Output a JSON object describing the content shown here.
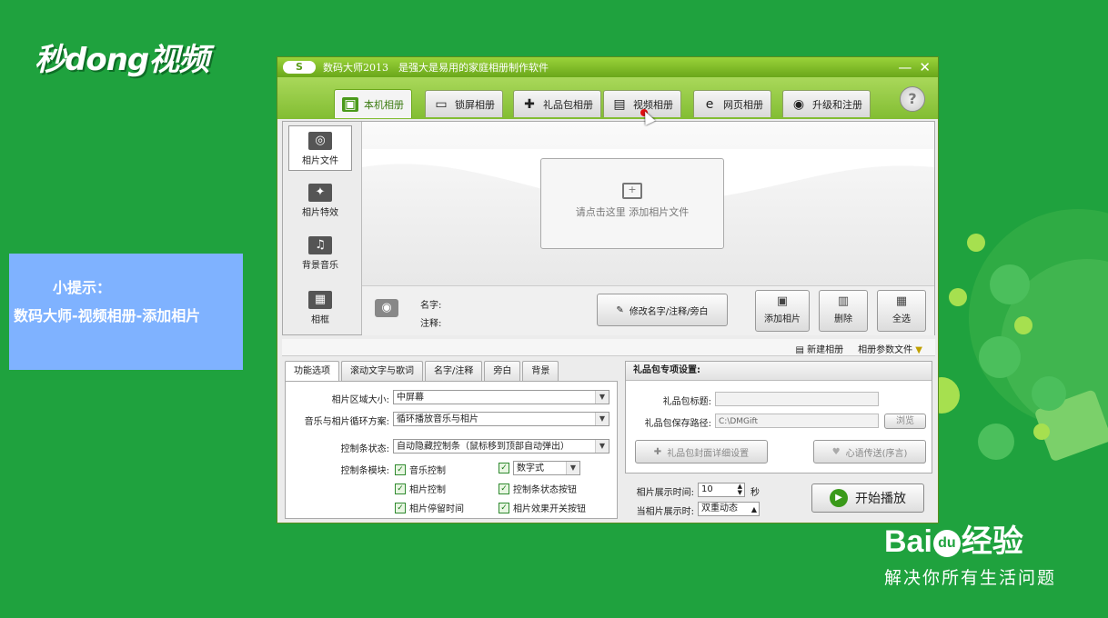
{
  "watermark": {
    "logo": "秒dong视频"
  },
  "tip": {
    "title": "小提示：",
    "text": "数码大师-视频相册-添加相片"
  },
  "baidu": {
    "logo_a": "Bai",
    "logo_du": "du",
    "logo_b": "经验",
    "slogan": "解决你所有生活问题"
  },
  "window": {
    "logo": "S",
    "title": "数码大师2013　是强大是易用的家庭相册制作软件",
    "minimize": "—",
    "close": "✕"
  },
  "tabs": [
    {
      "label": "本机相册",
      "icon": "person-photo-icon",
      "glyph": "▣"
    },
    {
      "label": "锁屏相册",
      "icon": "monitor-icon",
      "glyph": "▭"
    },
    {
      "label": "礼品包相册",
      "icon": "gift-icon",
      "glyph": "✚"
    },
    {
      "label": "视频相册",
      "icon": "film-icon",
      "glyph": "▤"
    },
    {
      "label": "网页相册",
      "icon": "ie-icon",
      "glyph": "e"
    },
    {
      "label": "升级和注册",
      "icon": "globe-icon",
      "glyph": "◉"
    }
  ],
  "help": "?",
  "sidenav": [
    {
      "label": "相片文件",
      "glyph": "◎"
    },
    {
      "label": "相片特效",
      "glyph": "✦"
    },
    {
      "label": "背景音乐",
      "glyph": "♫"
    },
    {
      "label": "相框",
      "glyph": "▦"
    }
  ],
  "canvas": {
    "add_hint": "请点击这里  添加相片文件",
    "add_glyph": "+"
  },
  "info": {
    "name_label": "名字:",
    "note_label": "注释:"
  },
  "actions": {
    "edit": "修改名字/注释/旁白",
    "add": "添加相片",
    "delete": "删除",
    "select_all": "全选"
  },
  "toolstrip": {
    "new_album": "新建相册",
    "album_params": "相册参数文件"
  },
  "subtabs": [
    "功能选项",
    "滚动文字与歌词",
    "名字/注释",
    "旁白",
    "背景"
  ],
  "options": {
    "area_label": "相片区域大小:",
    "area_value": "中屏幕",
    "loop_label": "音乐与相片循环方案:",
    "loop_value": "循环播放音乐与相片",
    "ctrl_state_label": "控制条状态:",
    "ctrl_state_value": "自动隐藏控制条（鼠标移到顶部自动弹出）",
    "ctrl_module_label": "控制条模块:",
    "checks": [
      {
        "label": "音乐控制",
        "checked": true
      },
      {
        "label": "数字式",
        "checked": true,
        "select": true
      },
      {
        "label": "相片控制",
        "checked": true
      },
      {
        "label": "控制条状态按钮",
        "checked": true
      },
      {
        "label": "相片停留时间",
        "checked": true
      },
      {
        "label": "相片效果开关按钮",
        "checked": true
      }
    ]
  },
  "gift": {
    "header": "礼品包专项设置:",
    "title_label": "礼品包标题:",
    "title_value": "",
    "path_label": "礼品包保存路径:",
    "path_value": "C:\\DMGift",
    "browse": "浏览",
    "cover_btn": "礼品包封面详细设置",
    "heart_btn": "心语传送(序言)"
  },
  "timing": {
    "show_label": "相片展示时间:",
    "show_value": "10",
    "unit": "秒",
    "when_label": "当相片展示时:",
    "when_value": "双重动态"
  },
  "play": {
    "label": "开始播放",
    "glyph": "▶"
  }
}
